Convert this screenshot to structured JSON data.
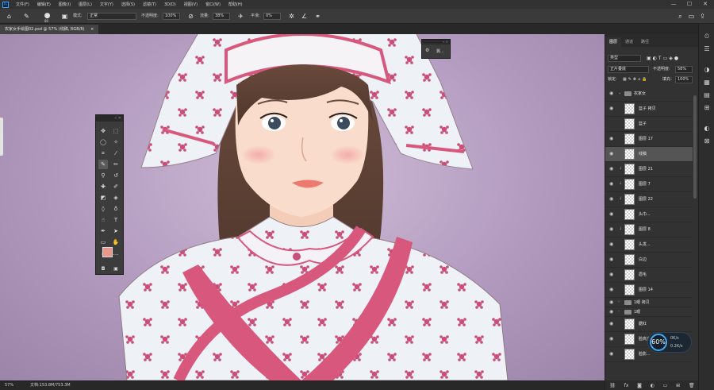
{
  "menubar": {
    "logo": "Ps",
    "items": [
      "文件(F)",
      "编辑(E)",
      "图像(I)",
      "图层(L)",
      "文字(Y)",
      "选择(S)",
      "滤镜(T)",
      "3D(D)",
      "视图(V)",
      "窗口(W)",
      "帮助(H)"
    ],
    "min": "—",
    "max": "☐",
    "close": "✕"
  },
  "options": {
    "brush_size": "80",
    "mode_label": "模式:",
    "mode_value": "正常",
    "opacity_label": "不透明度:",
    "opacity_value": "100%",
    "flow_label": "流量:",
    "flow_value": "38%",
    "smooth_label": "平滑:",
    "smooth_value": "0%"
  },
  "document": {
    "tab_title": "农家女手绘图02.psd @ 57% (线稿, RGB/8)",
    "close": "×"
  },
  "status": {
    "zoom": "57%",
    "doc_info": "文档:153.8M/753.3M"
  },
  "minipanel": {
    "label": "翼..."
  },
  "panel": {
    "tabs": [
      "图层",
      "通道",
      "路径"
    ],
    "filter_label": "类型",
    "blend_mode": "正片叠底",
    "opacity_label": "不透明度:",
    "opacity_value": "58%",
    "lock_label": "锁定:",
    "fill_label": "填充:",
    "fill_value": "100%",
    "layers": [
      {
        "name": "农家女",
        "group": true
      },
      {
        "name": "篮子 拷贝",
        "group": false
      },
      {
        "name": "篮子",
        "group": false
      },
      {
        "name": "图层 17",
        "group": false
      },
      {
        "name": "线稿",
        "group": false,
        "selected": true
      },
      {
        "name": "图层 21",
        "group": false
      },
      {
        "name": "图层 7",
        "group": false
      },
      {
        "name": "图层 22",
        "group": false
      },
      {
        "name": "头巾...",
        "group": false
      },
      {
        "name": "图层 8",
        "group": false
      },
      {
        "name": "头发...",
        "group": false
      },
      {
        "name": "白边",
        "group": false
      },
      {
        "name": "眉毛",
        "group": false
      },
      {
        "name": "图层 14",
        "group": false
      },
      {
        "name": "1眼 拷贝",
        "group": true
      },
      {
        "name": "1眼",
        "group": true
      },
      {
        "name": "腮红",
        "group": false
      },
      {
        "name": "脸高光...",
        "group": false
      },
      {
        "name": "脸影...",
        "group": false
      }
    ]
  },
  "perf": {
    "percent": "60%",
    "up": "0K/s",
    "down": "0.2K/s"
  },
  "colors": {
    "foreground": "#e8978a",
    "background": "#1a1a1a",
    "canvas_bg": "#b9a2c4",
    "accent_pink": "#d7587c"
  },
  "icons": [
    "home-icon",
    "brush-tool-icon",
    "brush-settings-icon",
    "airbrush-icon",
    "angle-icon",
    "pressure-icon",
    "symmetry-icon",
    "search-icon",
    "workspace-icon",
    "share-icon"
  ]
}
